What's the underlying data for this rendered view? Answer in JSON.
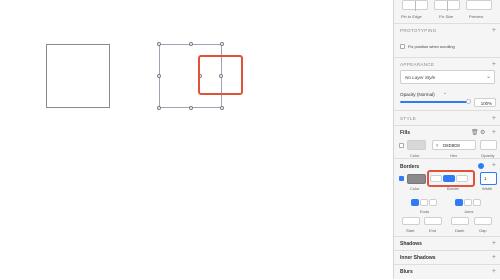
{
  "resizing": {
    "pin_label": "Pin to Edge",
    "fix_label": "Fix Size",
    "preview_label": "Preview"
  },
  "prototyping": {
    "title": "PROTOTYPING",
    "checkbox_label": "Fix position when scrolling"
  },
  "appearance": {
    "title": "APPEARANCE",
    "layer_style": "No Layer Style",
    "opacity_label": "Opacity (Normal)",
    "opacity_value": "100%",
    "opacity_fraction": 1.0
  },
  "style": {
    "title": "STYLE"
  },
  "fills": {
    "title": "Fills",
    "hex_prefix": "#",
    "hex_value": "D8D8D8",
    "color_label": "Color",
    "hex_label": "Hex",
    "opacity_label": "Opacity"
  },
  "borders": {
    "title": "Borders",
    "color_label": "Color",
    "position_label": "Border",
    "width_label": "Width",
    "width_value": "1",
    "ends_label": "Ends",
    "joins_label": "Joins",
    "start_label": "Start",
    "end_label": "End",
    "dash_label": "Dash",
    "gap_label": "Gap"
  },
  "shadows": {
    "title": "Shadows"
  },
  "inner_shadows": {
    "title": "Inner Shadows"
  },
  "blurs": {
    "title": "Blurs"
  },
  "colors": {
    "accent": "#2d7cf6",
    "highlight": "#e0533a",
    "fill_swatch": "#d8d8d8",
    "border_swatch": "#8a8a8a"
  }
}
